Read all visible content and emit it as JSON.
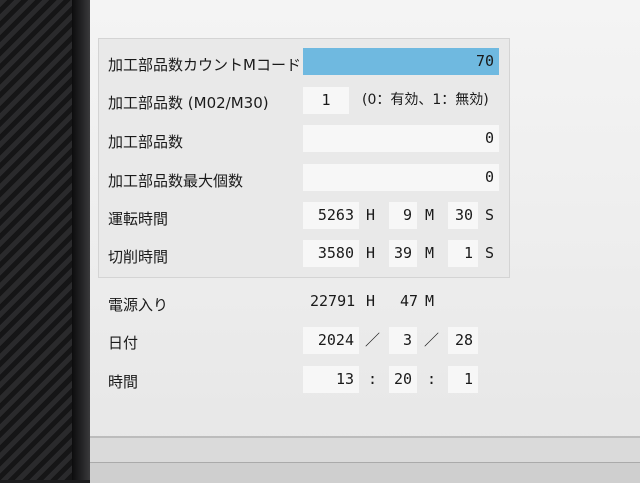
{
  "rows": {
    "count_mcode": {
      "label": "加工部品数カウントMコード",
      "value": "70"
    },
    "parts_count_mode": {
      "label": "加工部品数 (M02/M30)",
      "value": "1",
      "note": "(0：有効、1：無効)"
    },
    "parts_count": {
      "label": "加工部品数",
      "value": "0"
    },
    "parts_count_max": {
      "label": "加工部品数最大個数",
      "value": "0"
    },
    "run_time": {
      "label": "運転時間",
      "hours": "5263",
      "minutes": "9",
      "seconds": "30"
    },
    "cut_time": {
      "label": "切削時間",
      "hours": "3580",
      "minutes": "39",
      "seconds": "1"
    },
    "power_on": {
      "label": "電源入り",
      "hours": "22791",
      "minutes": "47"
    },
    "date": {
      "label": "日付",
      "year": "2024",
      "month": "3",
      "day": "28"
    },
    "time": {
      "label": "時間",
      "hour": "13",
      "minute": "20",
      "second": "1"
    }
  },
  "units": {
    "h": "H",
    "m": "M",
    "s": "S",
    "date_sep": "／",
    "time_sep": ":"
  }
}
